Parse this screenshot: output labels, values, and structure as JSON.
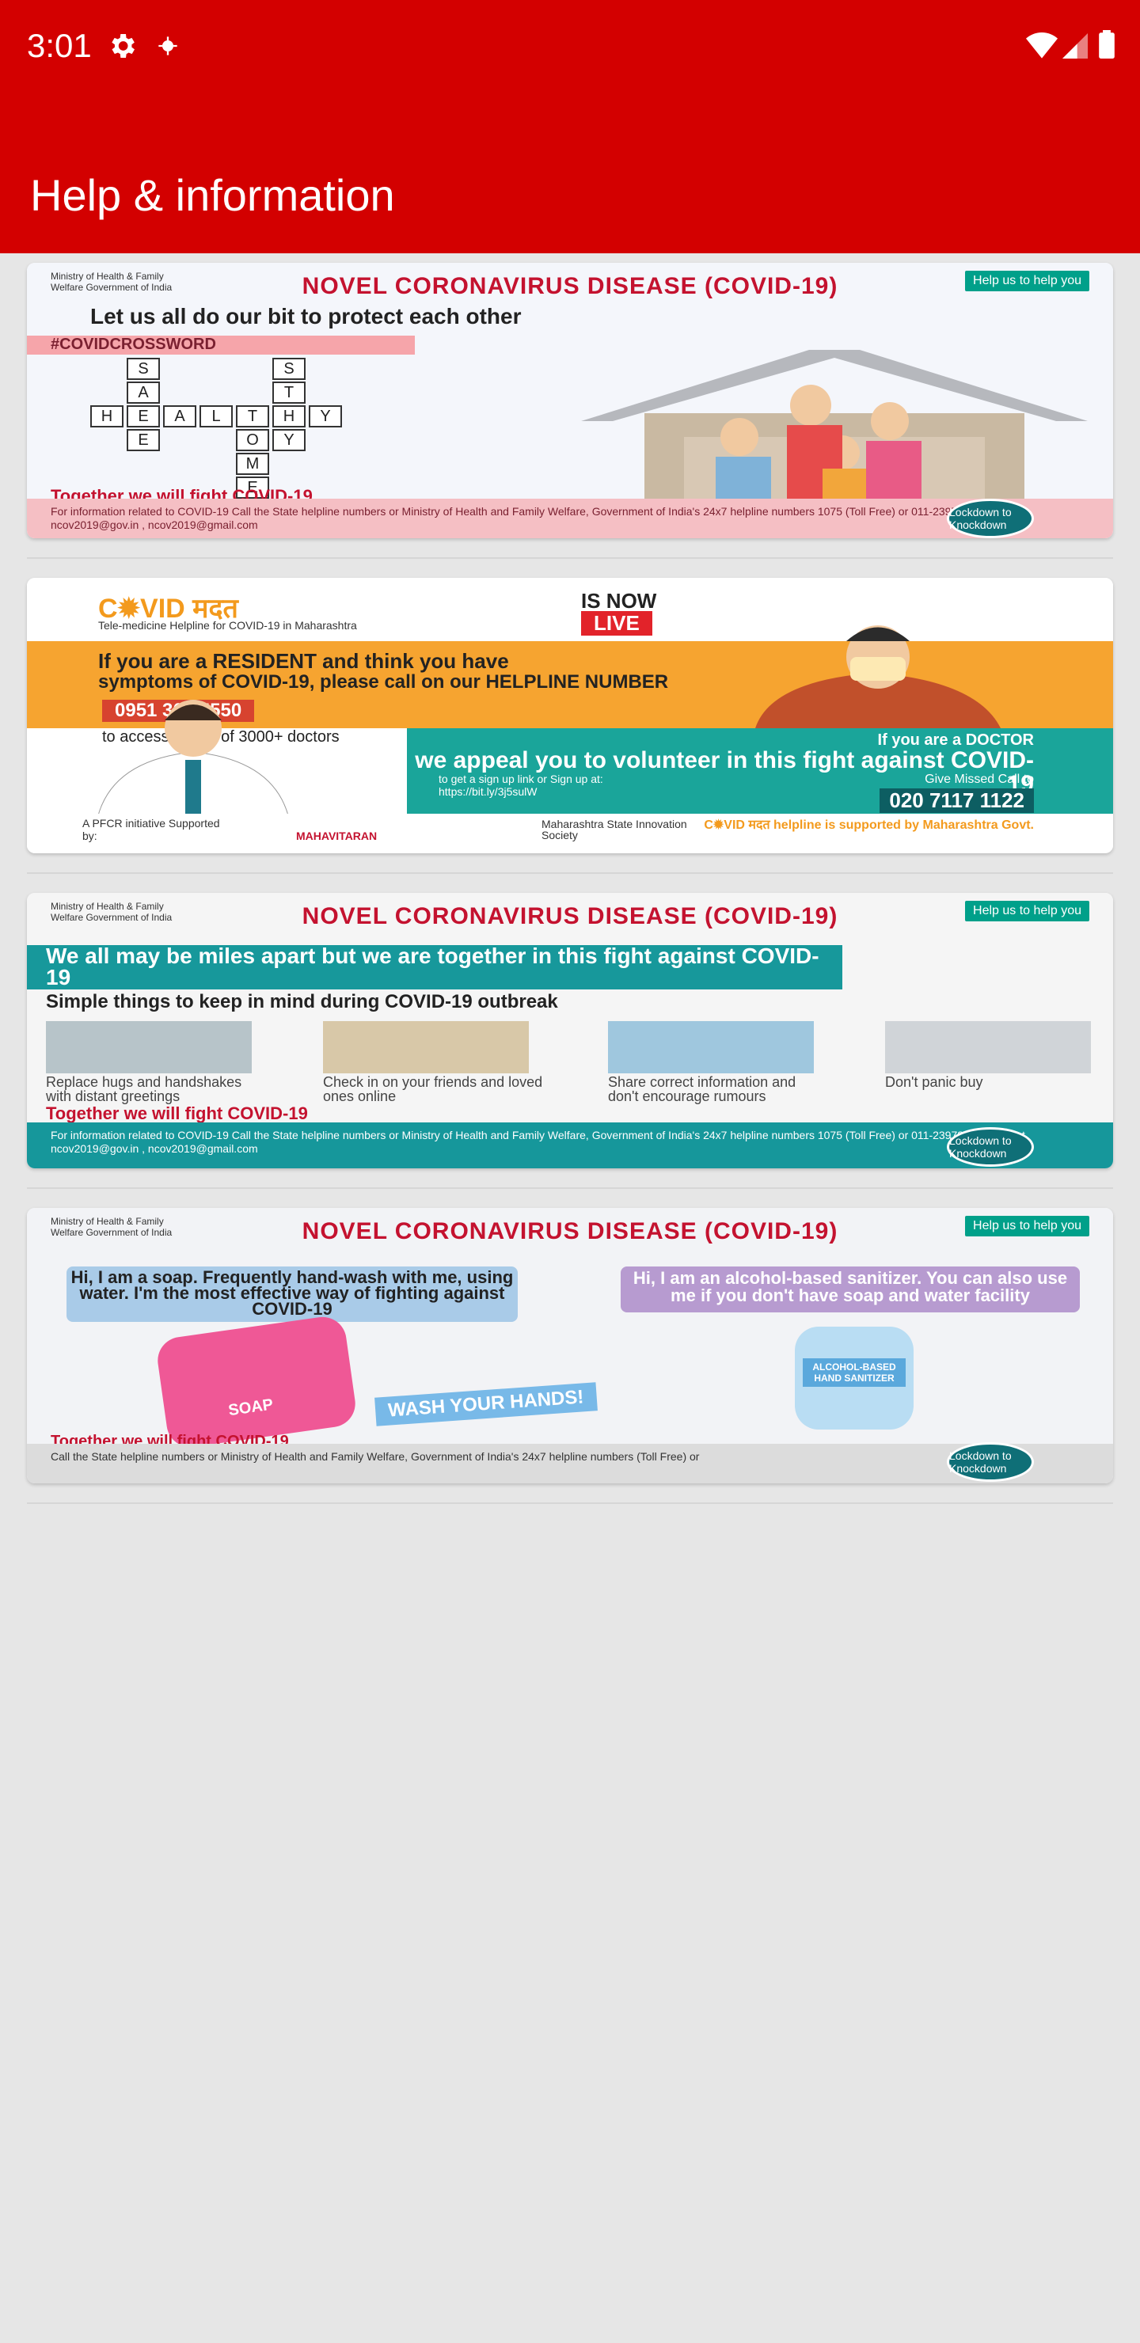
{
  "status_bar": {
    "time": "3:01",
    "icons": [
      "settings-icon",
      "notification-dot-icon",
      "wifi-icon",
      "signal-icon",
      "battery-icon"
    ]
  },
  "app_bar": {
    "title": "Help & information",
    "color": "#d30000"
  },
  "cards": [
    {
      "ministry": "Ministry of Health & Family Welfare Government of India",
      "badge": "Help us to help you",
      "header": "NOVEL CORONAVIRUS DISEASE (COVID-19)",
      "headline": "Let us all do our bit to protect each other",
      "hashtag": "#COVIDCROSSWORD",
      "crossword_across": "HEALTHY",
      "crossword_safe": "SAFE",
      "crossword_stay": "STAY",
      "crossword_home": "HOME",
      "tagline": "Together we will fight COVID-19",
      "footer": "For information related to COVID-19 Call the State helpline numbers or Ministry of Health and Family Welfare, Government of India's 24x7 helpline numbers 1075 (Toll Free) or 011-23978046 Email at ncov2019@gov.in , ncov2019@gmail.com",
      "lockdown": "Lockdown to Knockdown"
    },
    {
      "brand": "C✹VID मदत",
      "brand_sub": "Tele-medicine Helpline for COVID-19 in Maharashtra",
      "live_1": "IS NOW",
      "live_2": "LIVE",
      "resident_1": "If you are a RESIDENT and think you have",
      "resident_2": "symptoms of COVID-19, please call on our HELPLINE NUMBER",
      "phone_1": "0951 361 5550",
      "resident_3": "to access a pool of 3000+ doctors",
      "doctor_1": "If you are a DOCTOR",
      "doctor_2": "we appeal you to volunteer in this fight against COVID-19",
      "doctor_3": "Give Missed Call to",
      "phone_2": "020 7117 1122",
      "signup": "to get a sign up link or Sign up at: https://bit.ly/3j5sulW",
      "initiative": "A PFCR initiative Supported by:",
      "partners": [
        "MAHAVITARAN",
        "Maharashtra State Innovation Society"
      ],
      "credit": "C✹VID मदत helpline is supported by Maharashtra Govt."
    },
    {
      "ministry": "Ministry of Health & Family Welfare Government of India",
      "badge": "Help us to help you",
      "header": "NOVEL CORONAVIRUS DISEASE (COVID-19)",
      "headline": "We all may be miles apart but we are together in this fight against COVID-19",
      "subhead": "Simple things to keep in mind during COVID-19 outbreak",
      "tips": [
        "Replace hugs and handshakes with distant greetings",
        "Check in on your friends and loved ones online",
        "Share correct information and don't encourage rumours",
        "Don't panic buy"
      ],
      "tagline": "Together we will fight COVID-19",
      "footer": "For information related to COVID-19 Call the State helpline numbers or Ministry of Health and Family Welfare, Government of India's 24x7 helpline numbers 1075 (Toll Free) or 011-23978046 Email at ncov2019@gov.in , ncov2019@gmail.com",
      "lockdown": "Lockdown to Knockdown"
    },
    {
      "ministry": "Ministry of Health & Family Welfare Government of India",
      "badge": "Help us to help you",
      "header": "NOVEL CORONAVIRUS DISEASE (COVID-19)",
      "soap_bubble": "Hi, I am a soap. Frequently hand-wash with me, using water. I'm the most effective way of fighting against COVID-19",
      "sanitizer_bubble": "Hi, I am an alcohol-based sanitizer. You can also use me if you don't have soap and water facility",
      "soap_label": "SOAP",
      "wash": "WASH YOUR HANDS!",
      "sanitizer_label": "ALCOHOL-BASED HAND SANITIZER",
      "tagline": "Together we will fight COVID-19",
      "footer": "Call the State helpline numbers or Ministry of Health and Family Welfare, Government of India's 24x7 helpline numbers (Toll Free) or",
      "lockdown": "Lockdown to Knockdown"
    }
  ]
}
